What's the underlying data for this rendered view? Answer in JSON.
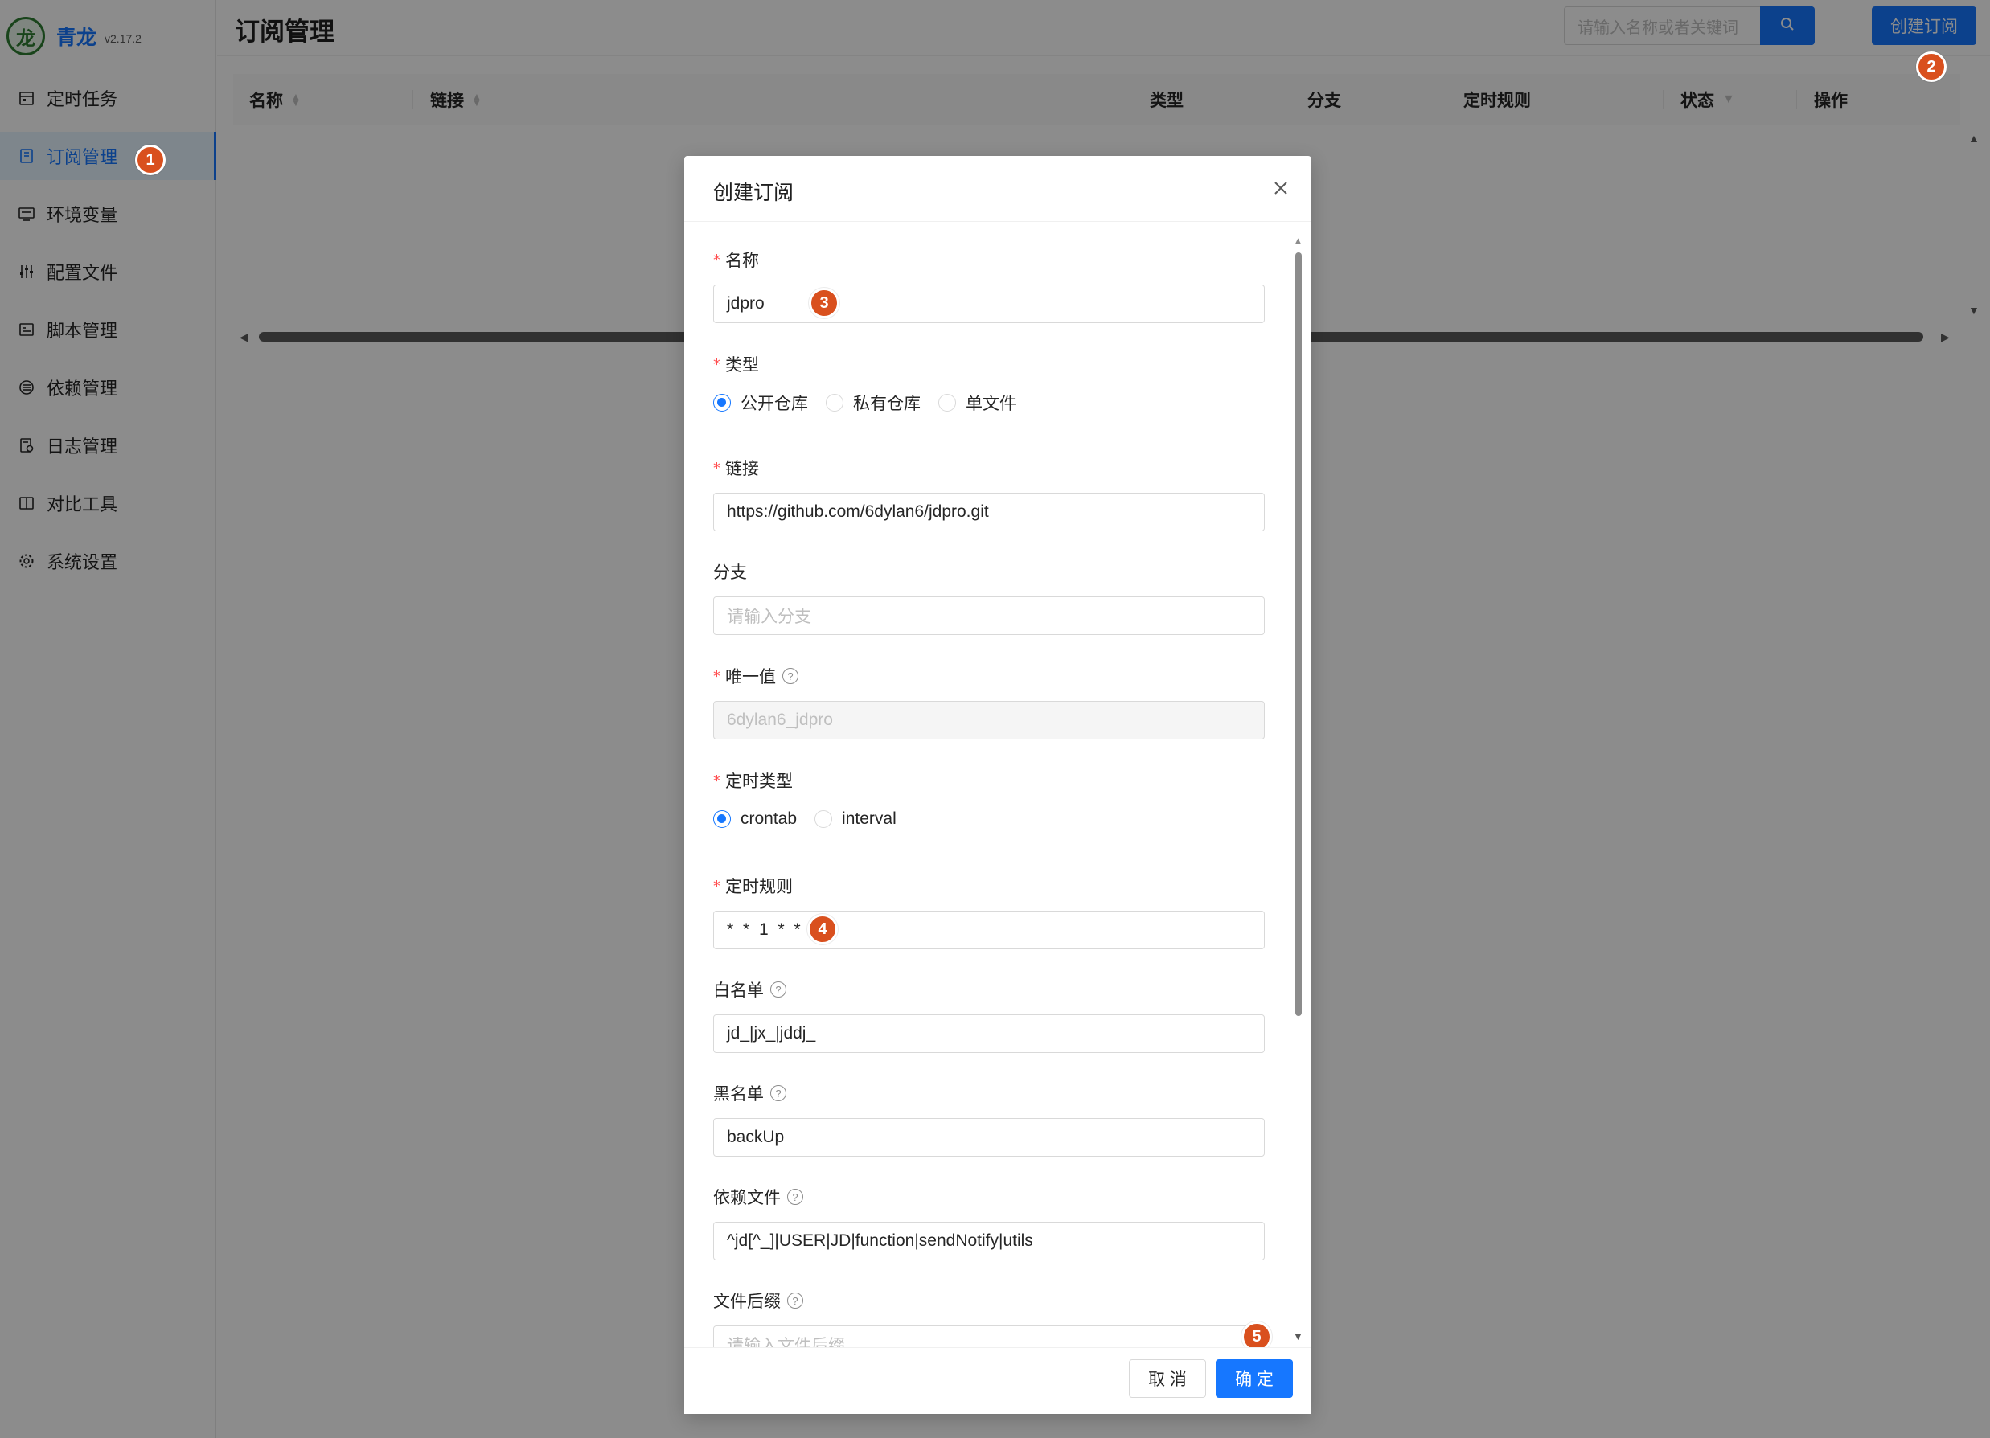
{
  "app": {
    "name": "青龙",
    "version": "v2.17.2",
    "logo_icon": "dragon-logo-icon"
  },
  "sidebar": {
    "items": [
      {
        "label": "定时任务",
        "icon": "calendar-icon"
      },
      {
        "label": "订阅管理",
        "icon": "subscription-icon",
        "active": true
      },
      {
        "label": "环境变量",
        "icon": "monitor-icon"
      },
      {
        "label": "配置文件",
        "icon": "sliders-icon"
      },
      {
        "label": "脚本管理",
        "icon": "script-icon"
      },
      {
        "label": "依赖管理",
        "icon": "layers-icon"
      },
      {
        "label": "日志管理",
        "icon": "log-icon"
      },
      {
        "label": "对比工具",
        "icon": "compare-icon"
      },
      {
        "label": "系统设置",
        "icon": "gear-icon"
      }
    ]
  },
  "header": {
    "title": "订阅管理",
    "search_placeholder": "请输入名称或者关键词",
    "create_button": "创建订阅"
  },
  "table": {
    "columns": [
      "名称",
      "链接",
      "类型",
      "分支",
      "定时规则",
      "状态",
      "操作"
    ]
  },
  "modal": {
    "title": "创建订阅",
    "fields": {
      "name": {
        "label": "名称",
        "value": "jdpro"
      },
      "type": {
        "label": "类型",
        "options": [
          "公开仓库",
          "私有仓库",
          "单文件"
        ],
        "selected": "公开仓库"
      },
      "link": {
        "label": "链接",
        "value": "https://github.com/6dylan6/jdpro.git"
      },
      "branch": {
        "label": "分支",
        "placeholder": "请输入分支"
      },
      "unique": {
        "label": "唯一值",
        "value": "6dylan6_jdpro"
      },
      "schedule_type": {
        "label": "定时类型",
        "options": [
          "crontab",
          "interval"
        ],
        "selected": "crontab"
      },
      "schedule_rule": {
        "label": "定时规则",
        "value": "* * 1 * *"
      },
      "whitelist": {
        "label": "白名单",
        "value": "jd_|jx_|jddj_"
      },
      "blacklist": {
        "label": "黑名单",
        "value": "backUp"
      },
      "dependency": {
        "label": "依赖文件",
        "value": "^jd[^_]|USER|JD|function|sendNotify|utils"
      },
      "suffix": {
        "label": "文件后缀",
        "placeholder": "请输入文件后缀"
      }
    },
    "cancel": "取 消",
    "ok": "确 定"
  },
  "annotations": [
    "1",
    "2",
    "3",
    "4",
    "5"
  ],
  "colors": {
    "accent": "#1677ff",
    "badge": "#d9501e",
    "required": "#ff4d4f"
  }
}
